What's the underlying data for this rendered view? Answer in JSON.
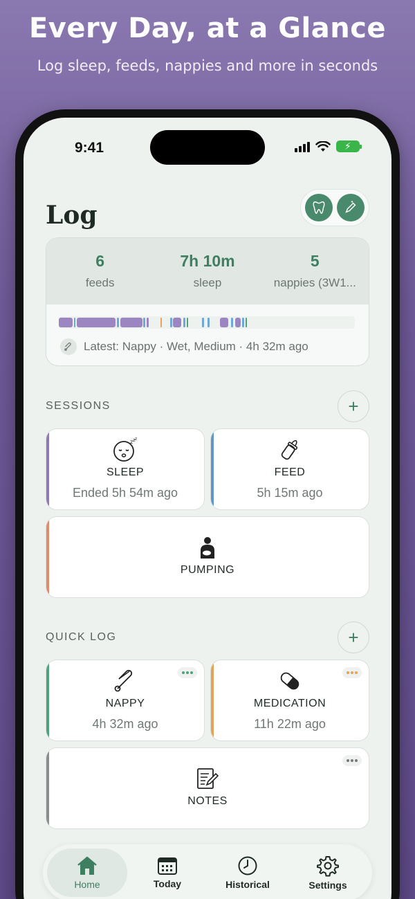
{
  "hero": {
    "title": "Every Day, at a Glance",
    "subtitle": "Log sleep, feeds, nappies and more in seconds"
  },
  "status_bar": {
    "time": "9:41"
  },
  "header": {
    "title": "Log",
    "actions": [
      {
        "icon": "tooth-icon"
      },
      {
        "icon": "magic-pencil-icon"
      }
    ]
  },
  "summary": {
    "stats": [
      {
        "value": "6",
        "label": "feeds"
      },
      {
        "value": "7h 10m",
        "label": "sleep"
      },
      {
        "value": "5",
        "label": "nappies (3W1..."
      }
    ],
    "latest": "Latest: Nappy · Wet, Medium · 4h 32m ago"
  },
  "sessions": {
    "heading": "SESSIONS",
    "add_label": "+",
    "items": [
      {
        "icon": "sleeping-face-icon",
        "label": "SLEEP",
        "sub": "Ended 5h 54m ago",
        "accent": "#8f78b6"
      },
      {
        "icon": "baby-bottle-icon",
        "label": "FEED",
        "sub": "5h 15m ago",
        "accent": "#5f98c8"
      },
      {
        "icon": "breast-pump-icon",
        "label": "PUMPING",
        "sub": "",
        "accent": "#e08a6e"
      }
    ]
  },
  "quick_log": {
    "heading": "QUICK LOG",
    "add_label": "+",
    "items": [
      {
        "icon": "safety-pin-icon",
        "label": "NAPPY",
        "sub": "4h 32m ago",
        "accent": "#4fa27c"
      },
      {
        "icon": "pill-icon",
        "label": "MEDICATION",
        "sub": "11h 22m ago",
        "accent": "#e5a35a"
      },
      {
        "icon": "notepad-icon",
        "label": "NOTES",
        "sub": "",
        "accent": "#8c8c8c"
      }
    ]
  },
  "tabbar": {
    "tabs": [
      {
        "label": "Home",
        "icon": "home-icon",
        "active": true
      },
      {
        "label": "Today",
        "icon": "calendar-icon",
        "active": false
      },
      {
        "label": "Historical",
        "icon": "clock-icon",
        "active": false
      },
      {
        "label": "Settings",
        "icon": "gear-icon",
        "active": false
      }
    ]
  },
  "colors": {
    "accent_green": "#3e7e61",
    "sleep_purple": "#8f78b6",
    "feed_blue": "#5f98c8"
  }
}
